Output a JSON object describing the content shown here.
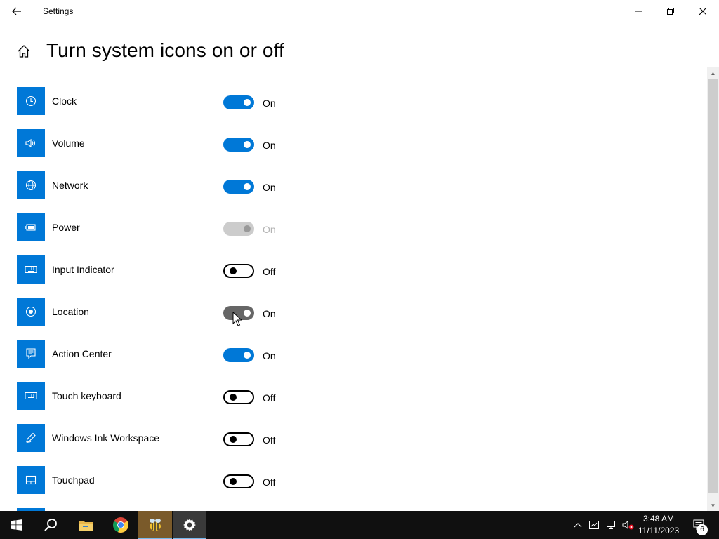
{
  "window": {
    "app_title": "Settings",
    "page_title": "Turn system icons on or off"
  },
  "items": [
    {
      "label": "Clock",
      "icon": "clock-icon",
      "state": "On",
      "toggle": "on"
    },
    {
      "label": "Volume",
      "icon": "volume-icon",
      "state": "On",
      "toggle": "on"
    },
    {
      "label": "Network",
      "icon": "network-globe-icon",
      "state": "On",
      "toggle": "on"
    },
    {
      "label": "Power",
      "icon": "battery-icon",
      "state": "On",
      "toggle": "disabled"
    },
    {
      "label": "Input Indicator",
      "icon": "keyboard-icon",
      "state": "Off",
      "toggle": "off"
    },
    {
      "label": "Location",
      "icon": "location-icon",
      "state": "On",
      "toggle": "pressed"
    },
    {
      "label": "Action Center",
      "icon": "action-center-icon",
      "state": "On",
      "toggle": "on"
    },
    {
      "label": "Touch keyboard",
      "icon": "touch-keyboard-icon",
      "state": "Off",
      "toggle": "off"
    },
    {
      "label": "Windows Ink Workspace",
      "icon": "pen-icon",
      "state": "Off",
      "toggle": "off"
    },
    {
      "label": "Touchpad",
      "icon": "touchpad-icon",
      "state": "Off",
      "toggle": "off"
    }
  ],
  "taskbar": {
    "apps": [
      "start-icon",
      "search-icon",
      "file-explorer-icon",
      "chrome-icon",
      "bee-app-icon",
      "settings-gear-icon"
    ],
    "time": "3:48 AM",
    "date": "11/11/2023",
    "notification_count": "6"
  },
  "colors": {
    "accent": "#0078d7",
    "taskbar": "#101010"
  }
}
